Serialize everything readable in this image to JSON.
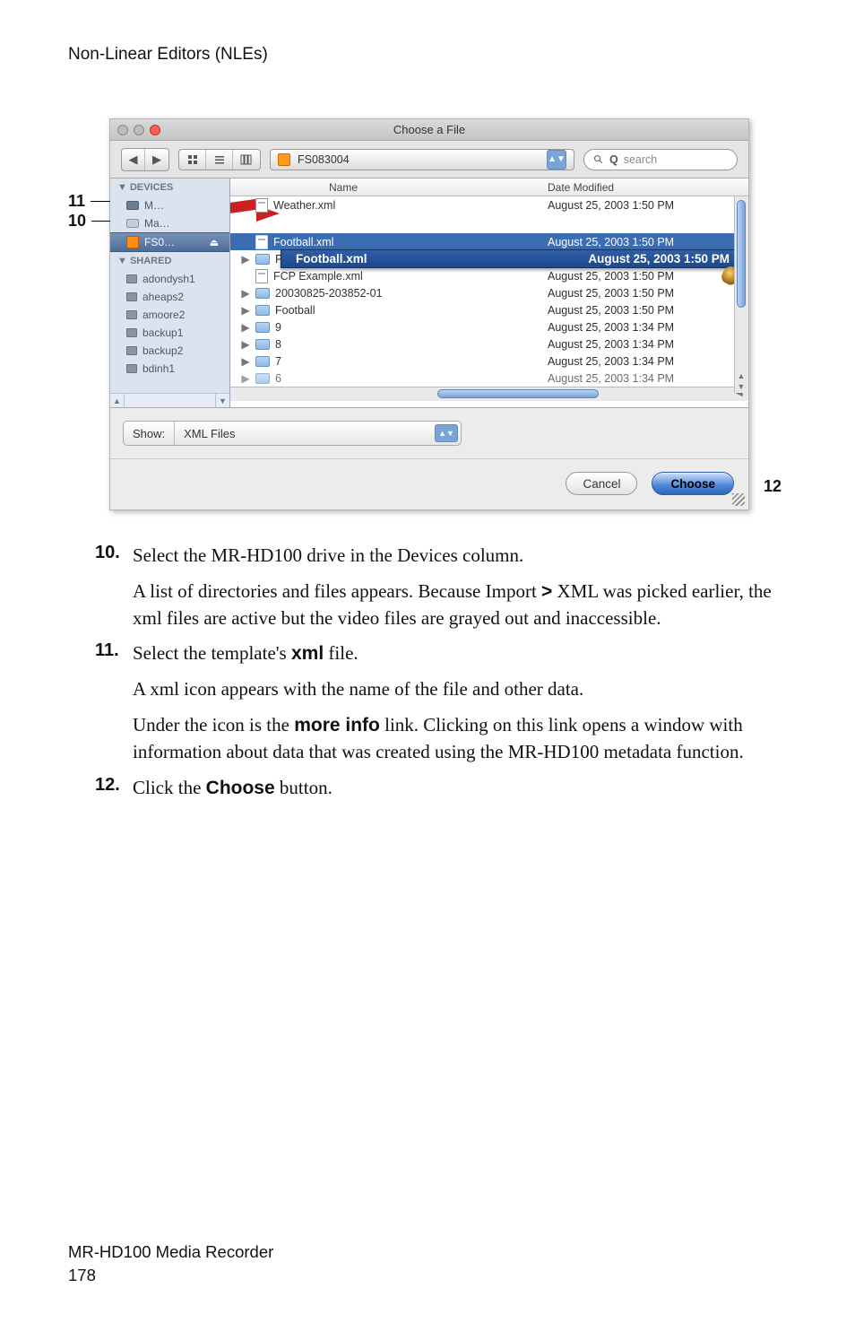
{
  "header": {
    "title": "Non-Linear Editors (NLEs)"
  },
  "callouts": {
    "top": "11",
    "bottom": "10",
    "right": "12"
  },
  "dialog": {
    "title": "Choose a File",
    "path_label": "FS083004",
    "search_placeholder": "search",
    "columns": {
      "name": "Name",
      "date": "Date Modified"
    },
    "sidebar": {
      "devices_header": "DEVICES",
      "item_network": "M…",
      "item_mac": "Ma…",
      "item_selected": "FS0…",
      "shared_header": "SHARED",
      "shared": [
        "adondysh1",
        "aheaps2",
        "amoore2",
        "backup1",
        "backup2",
        "bdinh1"
      ]
    },
    "tooltip": {
      "name": "Football.xml",
      "date": "August 25, 2003 1:50 PM"
    },
    "rows": [
      {
        "type": "xml",
        "name": "Weather.xml",
        "date": "August 25, 2003 1:50 PM",
        "disc": false
      },
      {
        "type": "spacer"
      },
      {
        "type": "xml-sel",
        "name": "Football.xml",
        "date": "August 25, 2003 1:50 PM",
        "disc": false
      },
      {
        "type": "folder",
        "name": "FCP_Example",
        "date": "August 25, 2003 1:50 PM",
        "disc": true
      },
      {
        "type": "xml",
        "name": "FCP Example.xml",
        "date": "August 25, 2003 1:50 PM",
        "disc": false
      },
      {
        "type": "folder",
        "name": "20030825-203852-01",
        "date": "August 25, 2003 1:50 PM",
        "disc": true
      },
      {
        "type": "folder",
        "name": "Football",
        "date": "August 25, 2003 1:50 PM",
        "disc": true
      },
      {
        "type": "folder",
        "name": "9",
        "date": "August 25, 2003 1:34 PM",
        "disc": true
      },
      {
        "type": "folder",
        "name": "8",
        "date": "August 25, 2003 1:34 PM",
        "disc": true
      },
      {
        "type": "folder",
        "name": "7",
        "date": "August 25, 2003 1:34 PM",
        "disc": true
      },
      {
        "type": "folder",
        "name": "6",
        "date": "August 25, 2003 1:34 PM",
        "disc": true
      }
    ],
    "show": {
      "label": "Show:",
      "value": "XML Files"
    },
    "buttons": {
      "cancel": "Cancel",
      "choose": "Choose"
    }
  },
  "steps": {
    "s10": {
      "num": "10.",
      "line1": "Select the MR-HD100 drive in the Devices column.",
      "line2a": "A list of directories and files appears. Because Import ",
      "line2b": " XML was picked earlier, the xml files are active but the video files are grayed out and inaccessible."
    },
    "s11": {
      "num": "11.",
      "line1a": "Select the template's ",
      "line1b": "xml",
      "line1c": " file.",
      "line2": "A xml icon appears with the name of the file and other data.",
      "line3a": "Under the icon is the ",
      "line3b": "more info",
      "line3c": " link. Clicking on this link opens a window with information about data that was created using the MR-HD100 metadata function."
    },
    "s12": {
      "num": "12.",
      "line1a": "Click the ",
      "line1b": "Choose",
      "line1c": " button."
    }
  },
  "footer": {
    "line1": "MR-HD100 Media Recorder",
    "line2": "178"
  }
}
